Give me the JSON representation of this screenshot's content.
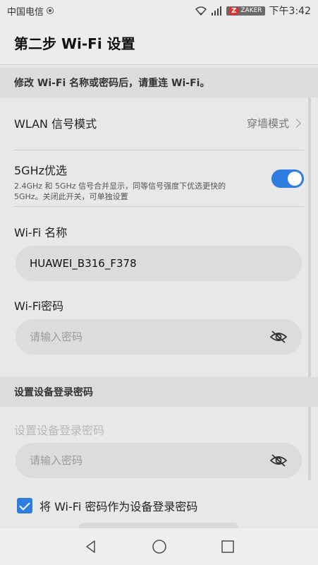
{
  "status_bar": {
    "carrier": "中国电信",
    "watermark": "ZAKER",
    "time": "下午3:42"
  },
  "page": {
    "title": "第二步 Wi-Fi 设置"
  },
  "wifi_section": {
    "header": "修改 Wi-Fi 名称或密码后，请重连 Wi-Fi。",
    "signal_mode": {
      "label": "WLAN 信号模式",
      "value": "穿墙模式"
    },
    "band_pref": {
      "title": "5GHz优选",
      "description": "2.4GHz 和 5GHz 信号合并显示，同等信号强度下优选更快的 5GHz。关闭此开关，可单独设置",
      "enabled": true
    },
    "wifi_name": {
      "label": "Wi-Fi 名称",
      "value": "HUAWEI_B316_F378"
    },
    "wifi_password": {
      "label": "Wi-Fi密码",
      "placeholder": "请输入密码"
    }
  },
  "login_section": {
    "header": "设置设备登录密码",
    "field_label": "设置设备登录密码",
    "placeholder": "请输入密码",
    "same_as_wifi": {
      "label": "将 Wi-Fi 密码作为设备登录密码",
      "checked": true
    }
  },
  "colors": {
    "accent": "#2f7de1",
    "background": "#e8e8e8"
  }
}
